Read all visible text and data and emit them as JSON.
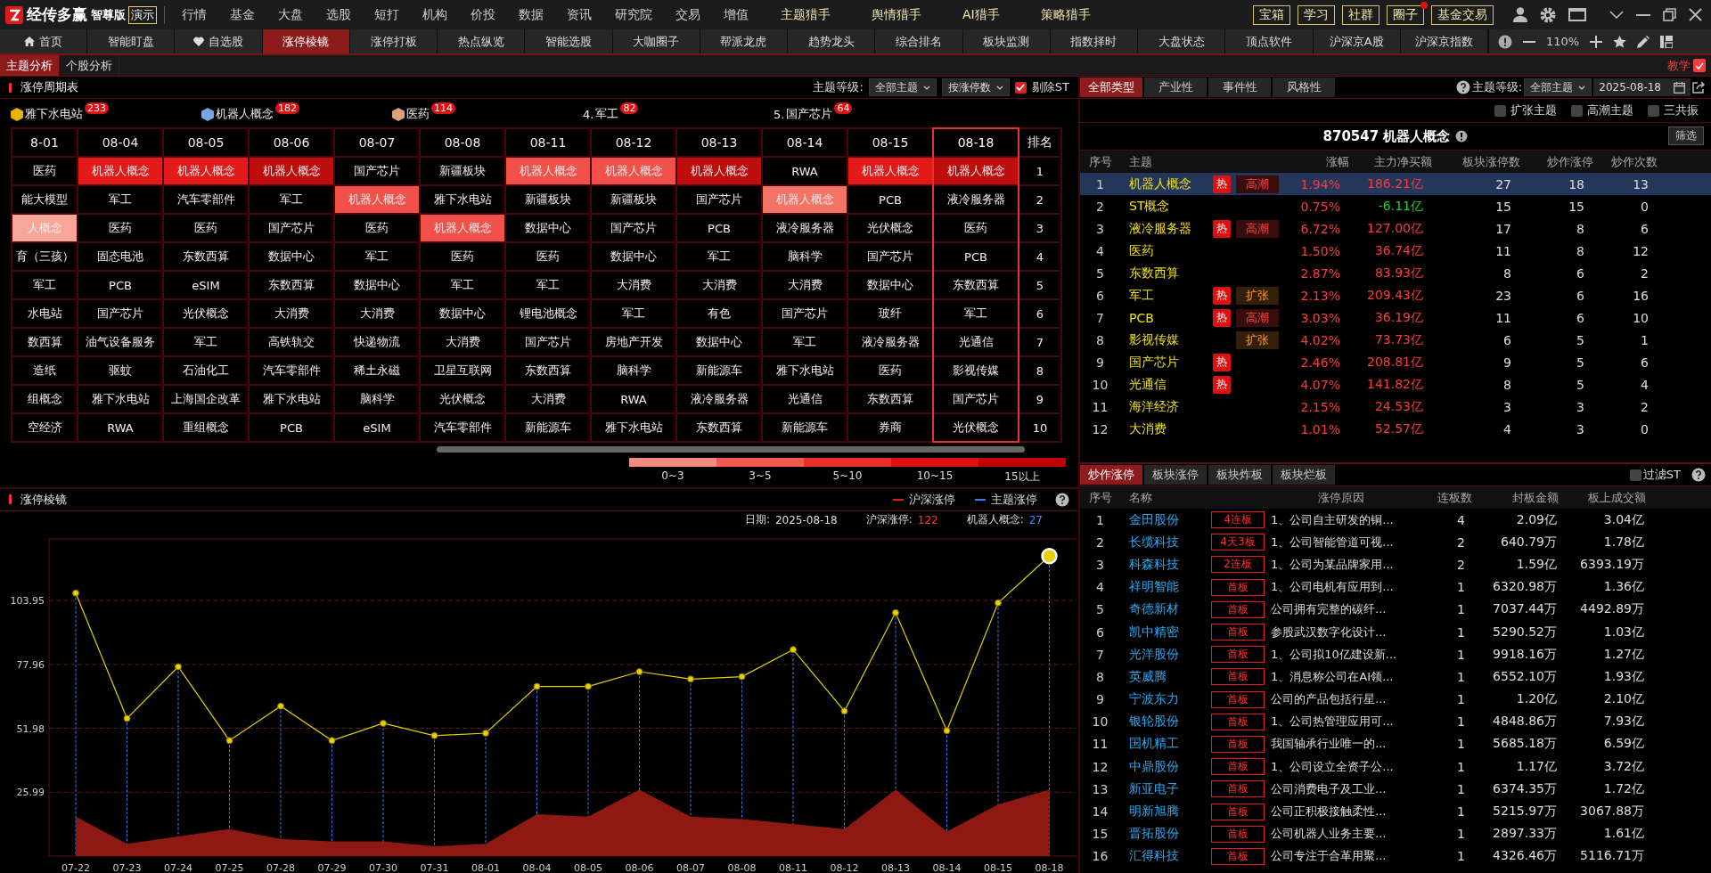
{
  "app_bar": {
    "logo": {
      "name": "经传多赢",
      "edition": "智尊版",
      "badge": "演示"
    },
    "menu": [
      {
        "label": "行情",
        "featured": false
      },
      {
        "label": "基金",
        "featured": false
      },
      {
        "label": "大盘",
        "featured": false
      },
      {
        "label": "选股",
        "featured": false
      },
      {
        "label": "短打",
        "featured": false
      },
      {
        "label": "机构",
        "featured": false
      },
      {
        "label": "价投",
        "featured": false
      },
      {
        "label": "数据",
        "featured": false
      },
      {
        "label": "资讯",
        "featured": false
      },
      {
        "label": "研究院",
        "featured": false
      },
      {
        "label": "交易",
        "featured": false
      },
      {
        "label": "增值",
        "featured": false
      },
      {
        "label": "主题猎手",
        "featured": true
      },
      {
        "label": "舆情猎手",
        "featured": true
      },
      {
        "label": "AI猎手",
        "featured": true
      },
      {
        "label": "策略猎手",
        "featured": true
      }
    ],
    "quick_buttons": [
      {
        "label": "宝箱",
        "dot": false
      },
      {
        "label": "学习",
        "dot": false
      },
      {
        "label": "社群",
        "dot": false
      },
      {
        "label": "圈子",
        "dot": true
      },
      {
        "label": "基金交易",
        "dot": false
      }
    ]
  },
  "module_tabs": [
    {
      "label": "首页",
      "kind": "home",
      "selected": false
    },
    {
      "label": "智能盯盘",
      "kind": "plain",
      "selected": false
    },
    {
      "label": "自选股",
      "kind": "heart",
      "selected": false
    },
    {
      "label": "涨停棱镜",
      "kind": "plain",
      "selected": true
    },
    {
      "label": "涨停打板",
      "kind": "plain",
      "selected": false
    },
    {
      "label": "热点纵览",
      "kind": "plain",
      "selected": false
    },
    {
      "label": "智能选股",
      "kind": "plain",
      "selected": false
    },
    {
      "label": "大咖圈子",
      "kind": "plain",
      "selected": false
    },
    {
      "label": "帮派龙虎",
      "kind": "plain",
      "selected": false
    },
    {
      "label": "趋势龙头",
      "kind": "plain",
      "selected": false
    },
    {
      "label": "综合排名",
      "kind": "plain",
      "selected": false
    },
    {
      "label": "板块监测",
      "kind": "plain",
      "selected": false
    },
    {
      "label": "指数择时",
      "kind": "plain",
      "selected": false
    },
    {
      "label": "大盘状态",
      "kind": "plain",
      "selected": false
    },
    {
      "label": "顶点软件",
      "kind": "plain",
      "selected": false
    },
    {
      "label": "沪深京A股",
      "kind": "plain",
      "selected": false
    },
    {
      "label": "沪深京指数",
      "kind": "plain",
      "selected": false
    }
  ],
  "zoom_level": "110%",
  "view_tabs": [
    {
      "label": "主题分析",
      "selected": true
    },
    {
      "label": "个股分析",
      "selected": false
    }
  ],
  "tutorial_link": "教学",
  "cycle_table": {
    "title": "涨停周期表",
    "level_label": "主题等级:",
    "level_select": "全部主题",
    "sort_select": "按涨停数",
    "exclude_st": {
      "label": "剔除ST",
      "checked": true
    },
    "leaders": [
      {
        "kind": "medal",
        "color": "#e8b400",
        "label": "雅下水电站",
        "count": "233"
      },
      {
        "kind": "medal",
        "color": "#7aa6e0",
        "label": "机器人概念",
        "count": "182"
      },
      {
        "kind": "medal",
        "color": "#d9a27a",
        "label": "医药",
        "count": "114"
      },
      {
        "kind": "numbered",
        "prefix": "4.",
        "label": "军工",
        "count": "82"
      },
      {
        "kind": "numbered",
        "prefix": "5.",
        "label": "国产芯片",
        "count": "64"
      }
    ],
    "columns": [
      {
        "label": "8-01",
        "selected": false
      },
      {
        "label": "08-04",
        "selected": false
      },
      {
        "label": "08-05",
        "selected": false
      },
      {
        "label": "08-06",
        "selected": false
      },
      {
        "label": "08-07",
        "selected": false
      },
      {
        "label": "08-08",
        "selected": false
      },
      {
        "label": "08-11",
        "selected": false
      },
      {
        "label": "08-12",
        "selected": false
      },
      {
        "label": "08-13",
        "selected": false
      },
      {
        "label": "08-14",
        "selected": false
      },
      {
        "label": "08-15",
        "selected": false
      },
      {
        "label": "08-18",
        "selected": true
      }
    ],
    "rank_header": "排名",
    "rows": [
      {
        "rank": "1",
        "cells": [
          {
            "text": "医药"
          },
          {
            "text": "机器人概念",
            "color": "#e31a1a"
          },
          {
            "text": "机器人概念",
            "color": "#e31a1a"
          },
          {
            "text": "机器人概念",
            "color": "#c00d0d"
          },
          {
            "text": "国产芯片"
          },
          {
            "text": "新疆板块"
          },
          {
            "text": "机器人概念",
            "color": "#f2504a"
          },
          {
            "text": "机器人概念",
            "color": "#f2504a"
          },
          {
            "text": "机器人概念",
            "color": "#c00d0d"
          },
          {
            "text": "RWA"
          },
          {
            "text": "机器人概念",
            "color": "#e31a1a"
          },
          {
            "text": "机器人概念",
            "color": "#c00d0d"
          }
        ]
      },
      {
        "rank": "2",
        "cells": [
          {
            "text": "能大模型"
          },
          {
            "text": "军工"
          },
          {
            "text": "汽车零部件"
          },
          {
            "text": "军工"
          },
          {
            "text": "机器人概念",
            "color": "#f2504a"
          },
          {
            "text": "雅下水电站"
          },
          {
            "text": "新疆板块"
          },
          {
            "text": "新疆板块"
          },
          {
            "text": "国产芯片"
          },
          {
            "text": "机器人概念",
            "color": "#f47266"
          },
          {
            "text": "PCB"
          },
          {
            "text": "液冷服务器"
          }
        ]
      },
      {
        "rank": "3",
        "cells": [
          {
            "text": "人概念",
            "color": "#f8a59a"
          },
          {
            "text": "医药"
          },
          {
            "text": "医药"
          },
          {
            "text": "国产芯片"
          },
          {
            "text": "医药"
          },
          {
            "text": "机器人概念",
            "color": "#f2504a"
          },
          {
            "text": "数据中心"
          },
          {
            "text": "国产芯片"
          },
          {
            "text": "PCB"
          },
          {
            "text": "液冷服务器"
          },
          {
            "text": "光伏概念"
          },
          {
            "text": "医药"
          }
        ]
      },
      {
        "rank": "4",
        "cells": [
          {
            "text": "育（三孩）"
          },
          {
            "text": "固态电池"
          },
          {
            "text": "东数西算"
          },
          {
            "text": "数据中心"
          },
          {
            "text": "军工"
          },
          {
            "text": "医药"
          },
          {
            "text": "医药"
          },
          {
            "text": "数据中心"
          },
          {
            "text": "军工"
          },
          {
            "text": "脑科学"
          },
          {
            "text": "国产芯片"
          },
          {
            "text": "PCB"
          }
        ]
      },
      {
        "rank": "5",
        "cells": [
          {
            "text": "军工"
          },
          {
            "text": "PCB"
          },
          {
            "text": "eSIM"
          },
          {
            "text": "东数西算"
          },
          {
            "text": "数据中心"
          },
          {
            "text": "军工"
          },
          {
            "text": "军工"
          },
          {
            "text": "大消费"
          },
          {
            "text": "大消费"
          },
          {
            "text": "大消费"
          },
          {
            "text": "数据中心"
          },
          {
            "text": "东数西算"
          }
        ]
      },
      {
        "rank": "6",
        "cells": [
          {
            "text": "水电站"
          },
          {
            "text": "国产芯片"
          },
          {
            "text": "光伏概念"
          },
          {
            "text": "大消费"
          },
          {
            "text": "大消费"
          },
          {
            "text": "数据中心"
          },
          {
            "text": "锂电池概念"
          },
          {
            "text": "军工"
          },
          {
            "text": "有色"
          },
          {
            "text": "国产芯片"
          },
          {
            "text": "玻纤"
          },
          {
            "text": "军工"
          }
        ]
      },
      {
        "rank": "7",
        "cells": [
          {
            "text": "数西算"
          },
          {
            "text": "油气设备服务"
          },
          {
            "text": "军工"
          },
          {
            "text": "高铁轨交"
          },
          {
            "text": "快递物流"
          },
          {
            "text": "大消费"
          },
          {
            "text": "国产芯片"
          },
          {
            "text": "房地产开发"
          },
          {
            "text": "数据中心"
          },
          {
            "text": "军工"
          },
          {
            "text": "液冷服务器"
          },
          {
            "text": "光通信"
          }
        ]
      },
      {
        "rank": "8",
        "cells": [
          {
            "text": "造纸"
          },
          {
            "text": "驱蚊"
          },
          {
            "text": "石油化工"
          },
          {
            "text": "汽车零部件"
          },
          {
            "text": "稀土永磁"
          },
          {
            "text": "卫星互联网"
          },
          {
            "text": "东数西算"
          },
          {
            "text": "脑科学"
          },
          {
            "text": "新能源车"
          },
          {
            "text": "雅下水电站"
          },
          {
            "text": "医药"
          },
          {
            "text": "影视传媒"
          }
        ]
      },
      {
        "rank": "9",
        "cells": [
          {
            "text": "组概念"
          },
          {
            "text": "雅下水电站"
          },
          {
            "text": "上海国企改革"
          },
          {
            "text": "雅下水电站"
          },
          {
            "text": "脑科学"
          },
          {
            "text": "光伏概念"
          },
          {
            "text": "大消费"
          },
          {
            "text": "RWA"
          },
          {
            "text": "液冷服务器"
          },
          {
            "text": "光通信"
          },
          {
            "text": "东数西算"
          },
          {
            "text": "国产芯片"
          }
        ]
      },
      {
        "rank": "10",
        "cells": [
          {
            "text": "空经济"
          },
          {
            "text": "RWA"
          },
          {
            "text": "重组概念"
          },
          {
            "text": "PCB"
          },
          {
            "text": "eSIM"
          },
          {
            "text": "汽车零部件"
          },
          {
            "text": "新能源车"
          },
          {
            "text": "雅下水电站"
          },
          {
            "text": "东数西算"
          },
          {
            "text": "新能源车"
          },
          {
            "text": "券商"
          },
          {
            "text": "光伏概念"
          }
        ]
      }
    ],
    "legend": [
      {
        "label": "0~3",
        "color": "#f58a80"
      },
      {
        "label": "3~5",
        "color": "#f25a50"
      },
      {
        "label": "5~10",
        "color": "#ee2e28"
      },
      {
        "label": "10~15",
        "color": "#de0f0f"
      },
      {
        "label": "15以上",
        "color": "#c00000"
      }
    ]
  },
  "prism_chart": {
    "title": "涨停棱镜",
    "legend": [
      {
        "color": "#e02020"
      },
      {
        "color": "#3a7cf0"
      }
    ],
    "info": [
      {
        "kind": "plain",
        "label": "日期:",
        "value": "2025-08-18"
      },
      {
        "kind": "market",
        "label": "沪深涨停:",
        "value": "122"
      },
      {
        "kind": "theme",
        "label": "机器人概念:",
        "value": "27"
      }
    ],
    "chart_data": {
      "type": "line",
      "categories": [
        "07-22",
        "07-23",
        "07-24",
        "07-25",
        "07-28",
        "07-29",
        "07-30",
        "07-31",
        "08-01",
        "08-04",
        "08-05",
        "08-06",
        "08-07",
        "08-08",
        "08-11",
        "08-12",
        "08-13",
        "08-14",
        "08-15",
        "08-18"
      ],
      "grid": true,
      "series": [
        {
          "name": "沪深涨停",
          "type": "line",
          "color": "#e8d000",
          "marker": true,
          "values": [
            107,
            56,
            77,
            47,
            61,
            47,
            54,
            49,
            50,
            69,
            69,
            75,
            72,
            73,
            84,
            59,
            99,
            51,
            103,
            122
          ]
        },
        {
          "name": "主题涨停",
          "type": "area",
          "color": "#8e1812",
          "values": [
            16,
            5,
            8,
            11,
            7,
            6,
            6,
            4,
            5,
            17,
            16,
            27,
            16,
            15,
            13,
            11,
            27,
            10,
            21,
            27
          ]
        }
      ],
      "ylim": [
        0,
        129
      ],
      "yticks": [
        25.99,
        51.98,
        77.96,
        103.95
      ],
      "annotations": [
        {
          "x": "08-18"
        }
      ]
    }
  },
  "theme_panel": {
    "tabs": [
      {
        "label": "全部类型",
        "selected": true
      },
      {
        "label": "产业性",
        "selected": false
      },
      {
        "label": "事件性",
        "selected": false
      },
      {
        "label": "风格性",
        "selected": false
      }
    ],
    "level_label": "主题等级:",
    "level_select": "全部主题",
    "date": "2025-08-18",
    "filters": [
      {
        "label": "扩张主题",
        "checked": false
      },
      {
        "label": "高潮主题",
        "checked": false
      },
      {
        "label": "三共振",
        "checked": false
      }
    ],
    "title": "870547 机器人概念",
    "filter_button": "筛选",
    "columns": [
      "序号",
      "主题",
      "涨幅",
      "主力净买额",
      "板块涨停数",
      "炒作涨停",
      "炒作次数"
    ],
    "rows": [
      {
        "no": "1",
        "name": "机器人概念",
        "hot_label": "热",
        "stage": {
          "kind": "climax",
          "label": "高潮"
        },
        "change": "1.94%",
        "net_buy": "186.21亿",
        "board_limit_ups": "27",
        "hype_limit_ups": "18",
        "hype_count": "13",
        "selected": true
      },
      {
        "no": "2",
        "name": "ST概念",
        "change": "0.75%",
        "net_buy": "-6.11亿",
        "board_limit_ups": "15",
        "hype_limit_ups": "15",
        "hype_count": "0",
        "selected": false
      },
      {
        "no": "3",
        "name": "液冷服务器",
        "hot_label": "热",
        "stage": {
          "kind": "climax",
          "label": "高潮"
        },
        "change": "6.72%",
        "net_buy": "127.00亿",
        "board_limit_ups": "17",
        "hype_limit_ups": "8",
        "hype_count": "6",
        "selected": false
      },
      {
        "no": "4",
        "name": "医药",
        "change": "1.50%",
        "net_buy": "36.74亿",
        "board_limit_ups": "11",
        "hype_limit_ups": "8",
        "hype_count": "12",
        "selected": false
      },
      {
        "no": "5",
        "name": "东数西算",
        "change": "2.87%",
        "net_buy": "83.93亿",
        "board_limit_ups": "8",
        "hype_limit_ups": "6",
        "hype_count": "2",
        "selected": false
      },
      {
        "no": "6",
        "name": "军工",
        "hot_label": "热",
        "stage": {
          "kind": "expansion",
          "label": "扩张"
        },
        "change": "2.13%",
        "net_buy": "209.43亿",
        "board_limit_ups": "23",
        "hype_limit_ups": "6",
        "hype_count": "16",
        "selected": false
      },
      {
        "no": "7",
        "name": "PCB",
        "hot_label": "热",
        "stage": {
          "kind": "climax",
          "label": "高潮"
        },
        "change": "3.03%",
        "net_buy": "36.19亿",
        "board_limit_ups": "11",
        "hype_limit_ups": "6",
        "hype_count": "10",
        "selected": false
      },
      {
        "no": "8",
        "name": "影视传媒",
        "stage": {
          "kind": "expansion",
          "label": "扩张"
        },
        "change": "4.02%",
        "net_buy": "73.73亿",
        "board_limit_ups": "6",
        "hype_limit_ups": "5",
        "hype_count": "1",
        "selected": false
      },
      {
        "no": "9",
        "name": "国产芯片",
        "hot_label": "热",
        "change": "2.46%",
        "net_buy": "208.81亿",
        "board_limit_ups": "9",
        "hype_limit_ups": "5",
        "hype_count": "6",
        "selected": false
      },
      {
        "no": "10",
        "name": "光通信",
        "hot_label": "热",
        "change": "4.07%",
        "net_buy": "141.82亿",
        "board_limit_ups": "8",
        "hype_limit_ups": "5",
        "hype_count": "4",
        "selected": false
      },
      {
        "no": "11",
        "name": "海洋经济",
        "change": "2.15%",
        "net_buy": "24.53亿",
        "board_limit_ups": "3",
        "hype_limit_ups": "3",
        "hype_count": "2",
        "selected": false
      },
      {
        "no": "12",
        "name": "大消费",
        "change": "1.01%",
        "net_buy": "52.57亿",
        "board_limit_ups": "4",
        "hype_limit_ups": "3",
        "hype_count": "0",
        "selected": false
      }
    ]
  },
  "stock_panel": {
    "tabs": [
      {
        "label": "炒作涨停",
        "selected": true
      },
      {
        "label": "板块涨停",
        "selected": false
      },
      {
        "label": "板块炸板",
        "selected": false
      },
      {
        "label": "板块烂板",
        "selected": false
      }
    ],
    "filter": {
      "label": "过滤ST",
      "checked": false
    },
    "columns": [
      "序号",
      "名称",
      "涨停原因",
      "连板数",
      "封板金额",
      "板上成交额"
    ],
    "rows": [
      {
        "no": "1",
        "name": "金田股份",
        "streak": "4连板",
        "reason": "1、公司自主研发的铜...",
        "boards": "4",
        "seal_amount": "2.09亿",
        "turnover": "3.04亿"
      },
      {
        "no": "2",
        "name": "长缆科技",
        "streak": "4天3板",
        "reason": "1、公司智能管道可视...",
        "boards": "2",
        "seal_amount": "640.79万",
        "turnover": "1.78亿"
      },
      {
        "no": "3",
        "name": "科森科技",
        "streak": "2连板",
        "reason": "1、公司为某品牌家用...",
        "boards": "2",
        "seal_amount": "1.59亿",
        "turnover": "6393.19万"
      },
      {
        "no": "4",
        "name": "祥明智能",
        "streak": "首板",
        "reason": "1、公司电机有应用到...",
        "boards": "1",
        "seal_amount": "6320.98万",
        "turnover": "1.36亿"
      },
      {
        "no": "5",
        "name": "奇德新材",
        "streak": "首板",
        "reason": "公司拥有完整的碳纤...",
        "boards": "1",
        "seal_amount": "7037.44万",
        "turnover": "4492.89万"
      },
      {
        "no": "6",
        "name": "凯中精密",
        "streak": "首板",
        "reason": "参股武汉数字化设计...",
        "boards": "1",
        "seal_amount": "5290.52万",
        "turnover": "1.03亿"
      },
      {
        "no": "7",
        "name": "光洋股份",
        "streak": "首板",
        "reason": "1、公司拟10亿建设新...",
        "boards": "1",
        "seal_amount": "9918.16万",
        "turnover": "1.27亿"
      },
      {
        "no": "8",
        "name": "英威腾",
        "streak": "首板",
        "reason": "1、消息称公司在AI领...",
        "boards": "1",
        "seal_amount": "6552.10万",
        "turnover": "1.93亿"
      },
      {
        "no": "9",
        "name": "宁波东力",
        "streak": "首板",
        "reason": "公司的产品包括行星...",
        "boards": "1",
        "seal_amount": "1.20亿",
        "turnover": "2.10亿"
      },
      {
        "no": "10",
        "name": "银轮股份",
        "streak": "首板",
        "reason": "1、公司热管理应用可...",
        "boards": "1",
        "seal_amount": "4848.86万",
        "turnover": "7.93亿"
      },
      {
        "no": "11",
        "name": "国机精工",
        "streak": "首板",
        "reason": "我国轴承行业唯一的...",
        "boards": "1",
        "seal_amount": "5685.18万",
        "turnover": "6.59亿"
      },
      {
        "no": "12",
        "name": "中鼎股份",
        "streak": "首板",
        "reason": "1、公司设立全资子公...",
        "boards": "1",
        "seal_amount": "1.17亿",
        "turnover": "3.72亿"
      },
      {
        "no": "13",
        "name": "新亚电子",
        "streak": "首板",
        "reason": "公司消费电子及工业...",
        "boards": "1",
        "seal_amount": "6374.35万",
        "turnover": "1.72亿"
      },
      {
        "no": "14",
        "name": "明新旭腾",
        "streak": "首板",
        "reason": "公司正积极接触柔性...",
        "boards": "1",
        "seal_amount": "5215.97万",
        "turnover": "3067.88万"
      },
      {
        "no": "15",
        "name": "晋拓股份",
        "streak": "首板",
        "reason": "公司机器人业务主要...",
        "boards": "1",
        "seal_amount": "2897.33万",
        "turnover": "1.61亿"
      },
      {
        "no": "16",
        "name": "汇得科技",
        "streak": "首板",
        "reason": "公司专注于合革用聚...",
        "boards": "1",
        "seal_amount": "4326.46万",
        "turnover": "5116.71万"
      }
    ]
  }
}
